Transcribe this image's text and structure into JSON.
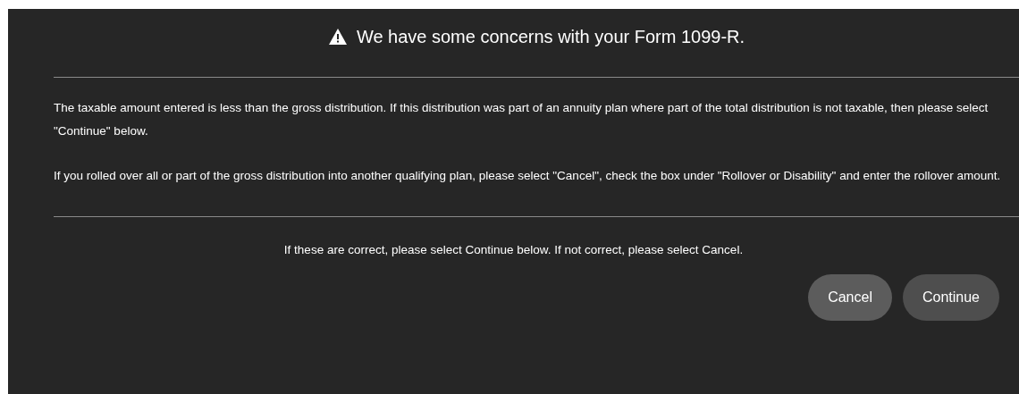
{
  "dialog": {
    "title": "We have some concerns with your Form 1099-R.",
    "paragraphs": [
      "The taxable amount entered is less than the gross distribution. If this distribution was part of an annuity plan where part of the total distribution is not taxable, then please select \"Continue\" below.",
      "If you rolled over all or part of the gross distribution into another qualifying plan, please select \"Cancel\", check the box under \"Rollover or Disability\" and enter the rollover amount."
    ],
    "prompt": "If these are correct, please select Continue below. If not correct, please select Cancel.",
    "buttons": [
      {
        "label": "Cancel",
        "kind": "secondary"
      },
      {
        "label": "Continue",
        "kind": "primary"
      }
    ]
  }
}
